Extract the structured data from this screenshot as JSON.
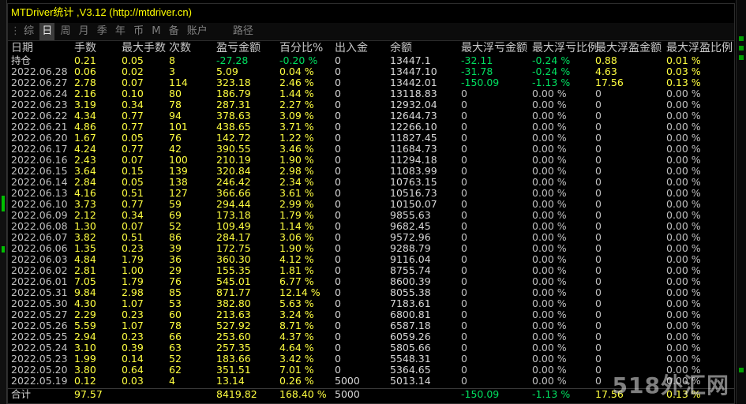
{
  "window": {
    "title": "MTDriver统计 ,V3.12 (http://mtdriver.cn)"
  },
  "tabs": [
    {
      "label": "综",
      "active": false
    },
    {
      "label": "日",
      "active": true
    },
    {
      "label": "周",
      "active": false
    },
    {
      "label": "月",
      "active": false
    },
    {
      "label": "季",
      "active": false
    },
    {
      "label": "年",
      "active": false
    },
    {
      "label": "币",
      "active": false
    },
    {
      "label": "M",
      "active": false
    },
    {
      "label": "备",
      "active": false
    },
    {
      "label": "账户",
      "active": false
    },
    {
      "label": "路径",
      "active": false
    }
  ],
  "table": {
    "headers": [
      "日期",
      "手数",
      "最大手数",
      "次数",
      "盈亏金额",
      "百分比%",
      "出入金",
      "余额",
      "最大浮亏金额",
      "最大浮亏比例",
      "最大浮盈金额",
      "最大浮盈比例"
    ],
    "holding": [
      "持仓",
      "0.21",
      "0.05",
      "8",
      "-27.28",
      "-0.20 %",
      "0",
      "13447.1",
      "-32.11",
      "-0.24 %",
      "0.88",
      "0.01 %"
    ],
    "rows": [
      [
        "2022.06.28",
        "0.06",
        "0.02",
        "3",
        "5.09",
        "0.04 %",
        "0",
        "13447.10",
        "-31.78",
        "-0.24 %",
        "4.63",
        "0.03 %"
      ],
      [
        "2022.06.27",
        "2.78",
        "0.07",
        "114",
        "323.18",
        "2.46 %",
        "0",
        "13442.01",
        "-150.09",
        "-1.13 %",
        "17.56",
        "0.13 %"
      ],
      [
        "2022.06.24",
        "2.16",
        "0.10",
        "80",
        "186.79",
        "1.44 %",
        "0",
        "13118.83",
        "0",
        "0.00 %",
        "0",
        "0.00 %"
      ],
      [
        "2022.06.23",
        "3.19",
        "0.34",
        "78",
        "287.31",
        "2.27 %",
        "0",
        "12932.04",
        "0",
        "0.00 %",
        "0",
        "0.00 %"
      ],
      [
        "2022.06.22",
        "4.34",
        "0.77",
        "94",
        "378.63",
        "3.09 %",
        "0",
        "12644.73",
        "0",
        "0.00 %",
        "0",
        "0.00 %"
      ],
      [
        "2022.06.21",
        "4.86",
        "0.77",
        "101",
        "438.65",
        "3.71 %",
        "0",
        "12266.10",
        "0",
        "0.00 %",
        "0",
        "0.00 %"
      ],
      [
        "2022.06.20",
        "1.67",
        "0.05",
        "76",
        "142.72",
        "1.22 %",
        "0",
        "11827.45",
        "0",
        "0.00 %",
        "0",
        "0.00 %"
      ],
      [
        "2022.06.17",
        "4.24",
        "0.77",
        "42",
        "390.55",
        "3.46 %",
        "0",
        "11684.73",
        "0",
        "0.00 %",
        "0",
        "0.00 %"
      ],
      [
        "2022.06.16",
        "2.43",
        "0.07",
        "100",
        "210.19",
        "1.90 %",
        "0",
        "11294.18",
        "0",
        "0.00 %",
        "0",
        "0.00 %"
      ],
      [
        "2022.06.15",
        "3.64",
        "0.15",
        "139",
        "320.84",
        "2.98 %",
        "0",
        "11083.99",
        "0",
        "0.00 %",
        "0",
        "0.00 %"
      ],
      [
        "2022.06.14",
        "2.84",
        "0.05",
        "138",
        "246.42",
        "2.34 %",
        "0",
        "10763.15",
        "0",
        "0.00 %",
        "0",
        "0.00 %"
      ],
      [
        "2022.06.13",
        "4.16",
        "0.51",
        "127",
        "366.66",
        "3.61 %",
        "0",
        "10516.73",
        "0",
        "0.00 %",
        "0",
        "0.00 %"
      ],
      [
        "2022.06.10",
        "3.73",
        "0.77",
        "59",
        "294.44",
        "2.99 %",
        "0",
        "10150.07",
        "0",
        "0.00 %",
        "0",
        "0.00 %"
      ],
      [
        "2022.06.09",
        "2.12",
        "0.34",
        "69",
        "173.18",
        "1.79 %",
        "0",
        "9855.63",
        "0",
        "0.00 %",
        "0",
        "0.00 %"
      ],
      [
        "2022.06.08",
        "1.30",
        "0.07",
        "52",
        "109.49",
        "1.14 %",
        "0",
        "9682.45",
        "0",
        "0.00 %",
        "0",
        "0.00 %"
      ],
      [
        "2022.06.07",
        "3.82",
        "0.51",
        "86",
        "284.17",
        "3.06 %",
        "0",
        "9572.96",
        "0",
        "0.00 %",
        "0",
        "0.00 %"
      ],
      [
        "2022.06.06",
        "1.35",
        "0.23",
        "39",
        "172.75",
        "1.90 %",
        "0",
        "9288.79",
        "0",
        "0.00 %",
        "0",
        "0.00 %"
      ],
      [
        "2022.06.03",
        "4.84",
        "1.79",
        "36",
        "360.30",
        "4.12 %",
        "0",
        "9116.04",
        "0",
        "0.00 %",
        "0",
        "0.00 %"
      ],
      [
        "2022.06.02",
        "2.81",
        "1.00",
        "29",
        "155.35",
        "1.81 %",
        "0",
        "8755.74",
        "0",
        "0.00 %",
        "0",
        "0.00 %"
      ],
      [
        "2022.06.01",
        "7.05",
        "1.79",
        "76",
        "545.01",
        "6.77 %",
        "0",
        "8600.39",
        "0",
        "0.00 %",
        "0",
        "0.00 %"
      ],
      [
        "2022.05.31",
        "9.84",
        "2.98",
        "85",
        "871.77",
        "12.14 %",
        "0",
        "8055.38",
        "0",
        "0.00 %",
        "0",
        "0.00 %"
      ],
      [
        "2022.05.30",
        "4.30",
        "1.07",
        "53",
        "382.80",
        "5.63 %",
        "0",
        "7183.61",
        "0",
        "0.00 %",
        "0",
        "0.00 %"
      ],
      [
        "2022.05.27",
        "2.29",
        "0.23",
        "60",
        "213.63",
        "3.24 %",
        "0",
        "6800.81",
        "0",
        "0.00 %",
        "0",
        "0.00 %"
      ],
      [
        "2022.05.26",
        "5.59",
        "1.07",
        "78",
        "527.92",
        "8.71 %",
        "0",
        "6587.18",
        "0",
        "0.00 %",
        "0",
        "0.00 %"
      ],
      [
        "2022.05.25",
        "2.94",
        "0.23",
        "66",
        "253.60",
        "4.37 %",
        "0",
        "6059.26",
        "0",
        "0.00 %",
        "0",
        "0.00 %"
      ],
      [
        "2022.05.24",
        "3.10",
        "0.39",
        "63",
        "257.35",
        "4.64 %",
        "0",
        "5805.66",
        "0",
        "0.00 %",
        "0",
        "0.00 %"
      ],
      [
        "2022.05.23",
        "1.99",
        "0.14",
        "52",
        "183.66",
        "3.42 %",
        "0",
        "5548.31",
        "0",
        "0.00 %",
        "0",
        "0.00 %"
      ],
      [
        "2022.05.20",
        "3.80",
        "0.64",
        "62",
        "351.51",
        "7.01 %",
        "0",
        "5364.65",
        "0",
        "0.00 %",
        "0",
        "0.00 %"
      ],
      [
        "2022.05.19",
        "0.12",
        "0.03",
        "4",
        "13.14",
        "0.26 %",
        "5000",
        "5013.14",
        "0",
        "0.00 %",
        "0",
        "0.00 %"
      ]
    ],
    "total": [
      "合计",
      "97.57",
      "",
      "",
      "8419.82",
      "168.40 %",
      "5000",
      "",
      "-150.09",
      "-1.13 %",
      "17.56",
      "0.13 %"
    ]
  },
  "colors": {
    "background": "#000000",
    "title": "#ffff00",
    "positive": "#ffff40",
    "negative": "#00e060",
    "neutral": "#c0c0c0"
  },
  "watermark": {
    "text": "518外汇网"
  }
}
